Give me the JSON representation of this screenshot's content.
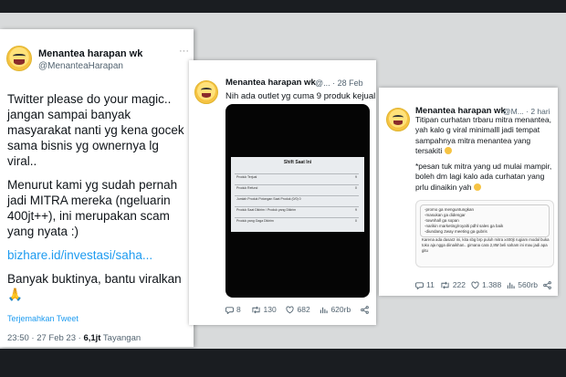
{
  "tweet1": {
    "name": "Menantea harapan wk",
    "handle": "@MenanteaHarapan",
    "paragraphs": [
      "Twitter please do your magic.. jangan sampai banyak masyarakat nanti yg kena gocek sama bisnis yg ownernya lg viral..",
      "Menurut kami yg sudah pernah jadi MITRA mereka (ngeluarin 400jt++), ini merupakan scam yang nyata :)"
    ],
    "link": "bizhare.id/investasi/saha...",
    "closing": "Banyak buktinya, bantu viralkan",
    "translate": "Terjemahkan Tweet",
    "time": "23:50 · 27 Feb 23 · ",
    "views": "6,1jt",
    "views_label": " Tayangan"
  },
  "tweet2": {
    "name": "Menantea harapan wk",
    "handle": "@... · 28 Feb",
    "text": "Nih ada outlet yg cuma 9 produk kejual",
    "screenshot": {
      "title": "Shift Saat Ini",
      "rows": [
        {
          "label": "Produk Terjual",
          "value": "9"
        },
        {
          "label": "Produk Refund",
          "value": "0"
        },
        {
          "label": "Jumlah Produk Potongan Saat Produk (0/0) 0",
          "value": ""
        },
        {
          "label": "Produk Saat Dikirim / Produk yang Dikirim",
          "value": "9"
        },
        {
          "label": "Produk yang Gaga Dikirim",
          "value": "0"
        }
      ]
    },
    "replies": "8",
    "retweets": "130",
    "likes": "682",
    "views": "620rb"
  },
  "tweet3": {
    "name": "Menantea harapan wk",
    "handle": "@M... · 2 hari",
    "p1": "Titipan curhatan trbaru mitra menantea, yah kalo g viral minimalll jadi tempat sampahnya mitra menantea yang tersakiti",
    "p2": "*pesan tuk mitra yang ud mulai mampir, boleh dm lagi kalo ada curhatan yang prlu dinaikin yah",
    "image_lines": [
      "-promo ga menguntungkan",
      "-masukan ga didengar",
      "-townhall ga sopan",
      "-narikin marketing/royalti pdhl sales ga baik",
      "-diundang 2way meeting ga gubris"
    ],
    "image_bottom": "Karena ada dasar2 ini, kita sbg brp puluh mitra x400jt rugiam modal buka toko aja ngga diinaikhan.. gimana cara 2,8M beli saham ini mau jadi apa gitu",
    "replies": "11",
    "retweets": "222",
    "likes": "1.388",
    "views": "560rb"
  }
}
